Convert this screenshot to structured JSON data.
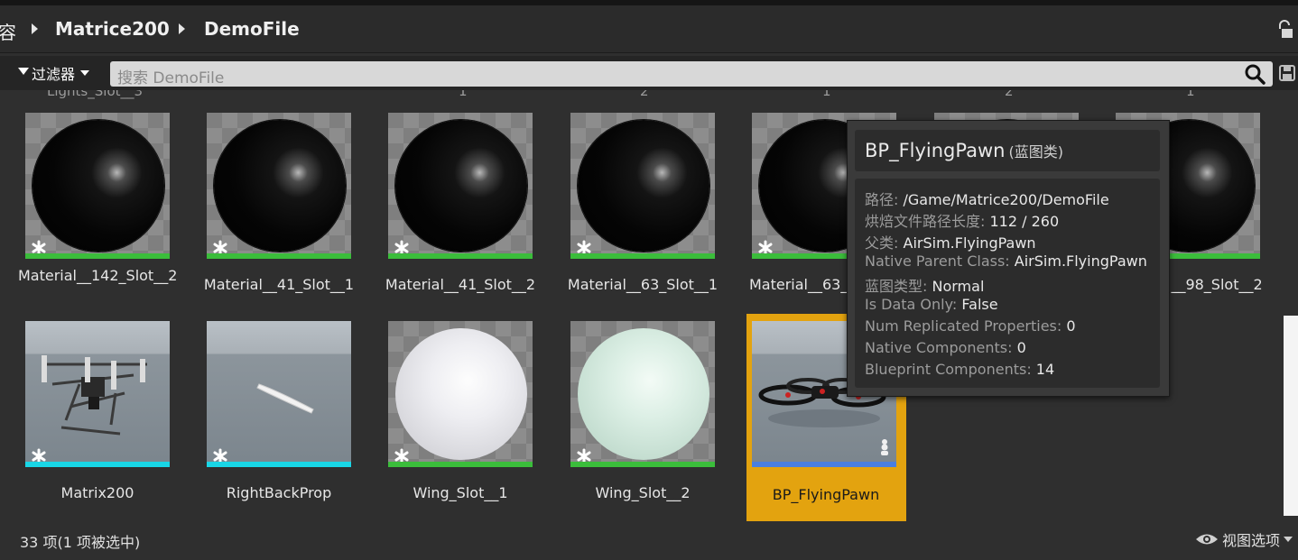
{
  "breadcrumb": {
    "partial": "容",
    "items": [
      "Matrice200",
      "DemoFile"
    ]
  },
  "filter": {
    "label": "过滤器"
  },
  "search": {
    "placeholder": "搜索 DemoFile"
  },
  "cut_row_labels": [
    "Lights_Slot__3",
    "1",
    "2",
    "1",
    "2",
    "1"
  ],
  "assets_row1": [
    {
      "label": "Material__142_Slot__2",
      "thumb": "black-sphere",
      "bar": "green"
    },
    {
      "label": "Material__41_Slot__1",
      "thumb": "black-sphere",
      "bar": "green"
    },
    {
      "label": "Material__41_Slot__2",
      "thumb": "black-sphere",
      "bar": "green"
    },
    {
      "label": "Material__63_Slot__1",
      "thumb": "black-sphere",
      "bar": "green"
    },
    {
      "label": "Material__63_",
      "thumb": "black-sphere",
      "bar": "green"
    },
    {
      "label": "",
      "thumb": "black-sphere",
      "bar": "green"
    },
    {
      "label": "l__98_Slot__2",
      "thumb": "black-sphere",
      "bar": "green"
    }
  ],
  "assets_row2": [
    {
      "label": "Matrix200",
      "thumb": "drone-mesh",
      "bar": "cyan"
    },
    {
      "label": "RightBackProp",
      "thumb": "propeller-mesh",
      "bar": "cyan"
    },
    {
      "label": "Wing_Slot__1",
      "thumb": "white-sphere",
      "bar": "green"
    },
    {
      "label": "Wing_Slot__2",
      "thumb": "mint-sphere",
      "bar": "green"
    },
    {
      "label": "BP_FlyingPawn",
      "thumb": "quadcopter",
      "bar": "blue",
      "selected": true
    }
  ],
  "tooltip": {
    "title": "BP_FlyingPawn",
    "class_tag": "(蓝图类)",
    "rows": [
      {
        "key": "路径:",
        "value": "/Game/Matrice200/DemoFile"
      },
      {
        "key": "烘焙文件路径长度:",
        "value": "112 / 260"
      },
      {
        "key": "父类:",
        "value": "AirSim.FlyingPawn"
      },
      {
        "key": "Native Parent Class:",
        "value": "AirSim.FlyingPawn"
      },
      {
        "key": "蓝图类型:",
        "value": "Normal"
      },
      {
        "key": "Is Data Only:",
        "value": "False"
      },
      {
        "key": "Num Replicated Properties:",
        "value": "0"
      },
      {
        "key": "Native Components:",
        "value": "0"
      },
      {
        "key": "Blueprint Components:",
        "value": "14"
      }
    ]
  },
  "status": {
    "count": "33 项(1 项被选中)",
    "view_options": "视图选项"
  },
  "colors": {
    "selection": "#e3a30f",
    "material_bar": "#3bbd3b",
    "mesh_bar": "#19d6e6",
    "blueprint_bar": "#4a7fe0"
  }
}
